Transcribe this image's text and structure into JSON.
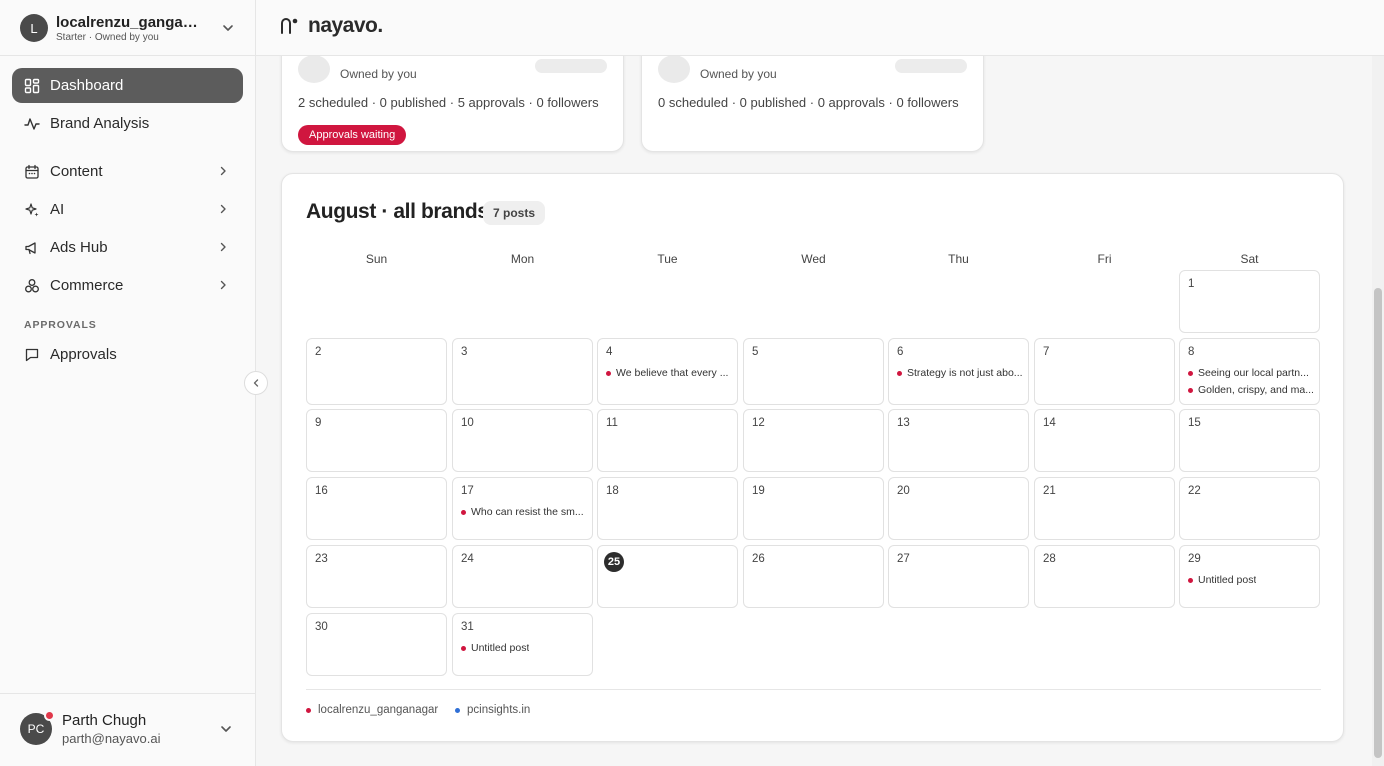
{
  "workspace": {
    "initial": "L",
    "name": "localrenzu_gangana...",
    "sub": "Starter · Owned by you"
  },
  "nav": {
    "dashboard": "Dashboard",
    "brand_analysis": "Brand Analysis",
    "content": "Content",
    "ai": "AI",
    "ads_hub": "Ads Hub",
    "commerce": "Commerce",
    "section_approvals": "APPROVALS",
    "approvals": "Approvals"
  },
  "user": {
    "initials": "PC",
    "name": "Parth Chugh",
    "email": "parth@nayavo.ai"
  },
  "header": {
    "logo": "nayavo."
  },
  "brand_cards": [
    {
      "owned": "Owned by you",
      "stats": "2 scheduled · 0 published · 5 approvals · 0 followers",
      "badge": "Approvals waiting"
    },
    {
      "owned": "Owned by you",
      "stats": "0 scheduled · 0 published · 0 approvals · 0 followers"
    }
  ],
  "calendar": {
    "title": "August · all brands",
    "count": "7 posts",
    "weekdays": [
      "Sun",
      "Mon",
      "Tue",
      "Wed",
      "Thu",
      "Fri",
      "Sat"
    ],
    "days": [
      "1",
      "2",
      "3",
      "4",
      "5",
      "6",
      "7",
      "8",
      "9",
      "10",
      "11",
      "12",
      "13",
      "14",
      "15",
      "16",
      "17",
      "18",
      "19",
      "20",
      "21",
      "22",
      "23",
      "24",
      "25",
      "26",
      "27",
      "28",
      "29",
      "30",
      "31"
    ],
    "today": "25",
    "posts": {
      "d4": "We believe that every ...",
      "d6": "Strategy is not just abo...",
      "d8a": "Seeing our local partn...",
      "d8b": "Golden, crispy, and ma...",
      "d17": "Who can resist the sm...",
      "d29": "Untitled post",
      "d31": "Untitled post"
    },
    "legend": [
      {
        "name": "localrenzu_ganganagar",
        "color": "#d0163f"
      },
      {
        "name": "pcinsights.in",
        "color": "#2f6fd6"
      }
    ]
  },
  "colors": {
    "accent_red": "#d0163f",
    "active_nav": "#5c5c5c"
  }
}
